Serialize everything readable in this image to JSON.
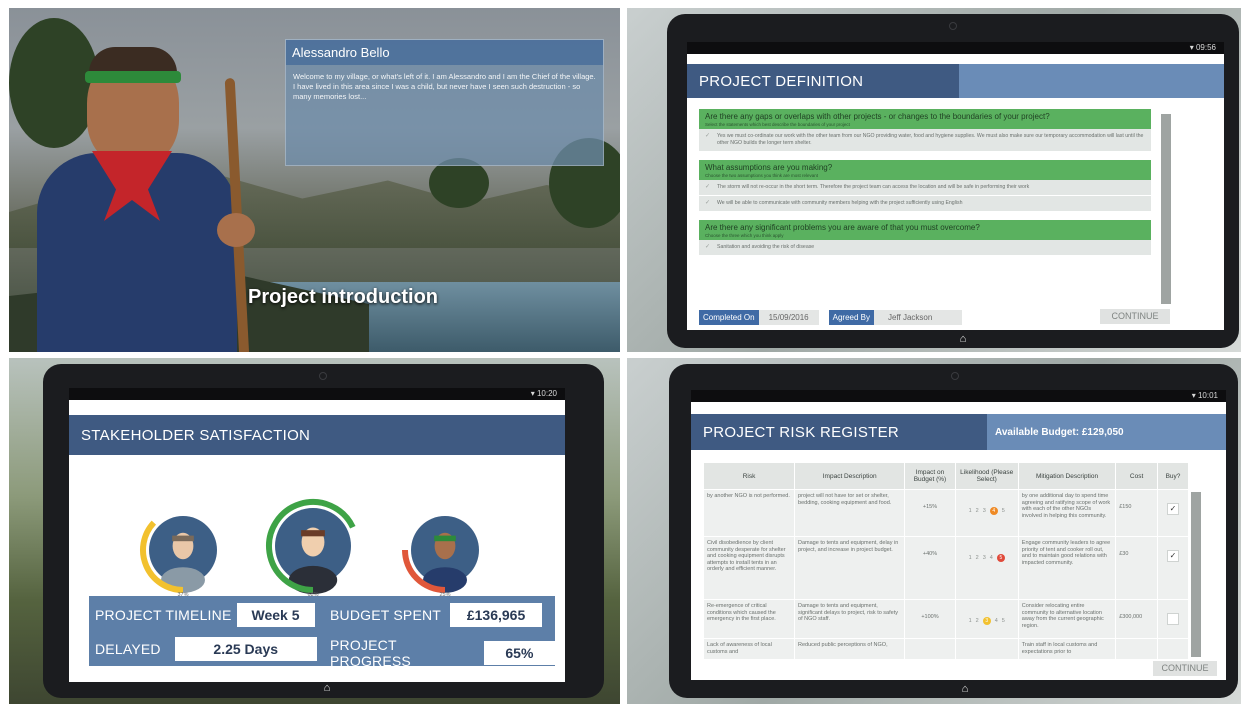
{
  "q1": {
    "character_name": "Alessandro Bello",
    "dialog": "Welcome to my village, or what's left of it. I am Alessandro and I am the Chief of the village. I have lived in this area since I was a child, but never have I seen such destruction - so many memories lost...",
    "title": "Project introduction",
    "character_icon": "village-chief-avatar"
  },
  "q2": {
    "time": "09:56",
    "title": "PROJECT DEFINITION",
    "sections": [
      {
        "question": "Are there any gaps or overlaps with other projects - or changes to the boundaries of your project?",
        "sub": "Select the statements which best describe the boundaries of your project",
        "answers": [
          "Yes we must co-ordinate our work with the other team from our NGO providing water, food and hygiene supplies. We must also make sure our temporary accommodation will last until the other NGO builds the longer term shelter."
        ]
      },
      {
        "question": "What assumptions are you making?",
        "sub": "Choose the two assumptions you think are most relevant",
        "answers": [
          "The storm will not re-occur in the short term. Therefore the project team can access the location and will be safe in performing their work",
          "We will be able to communicate with community members helping with the project sufficiently using English"
        ]
      },
      {
        "question": "Are there any significant problems you are aware of that you must overcome?",
        "sub": "Choose the three which you think apply",
        "answers": [
          "Sanitation and avoiding the risk of disease"
        ]
      }
    ],
    "footer": {
      "completed_label": "Completed On",
      "completed_value": "15/09/2016",
      "agreed_label": "Agreed By",
      "agreed_value": "Jeff Jackson",
      "continue_label": "CONTINUE"
    }
  },
  "q3": {
    "time": "10:20",
    "title": "STAKEHOLDER SATISFACTION",
    "stakeholders": [
      {
        "percent": "37%",
        "fraction": 0.37,
        "color": "#f2c12e"
      },
      {
        "percent": "68%",
        "fraction": 0.68,
        "color": "#3ea346"
      },
      {
        "percent": "25%",
        "fraction": 0.25,
        "color": "#e0573a"
      }
    ],
    "stats": {
      "timeline_label": "PROJECT TIMELINE",
      "timeline_value": "Week 5",
      "budget_label": "BUDGET SPENT",
      "budget_value": "£136,965",
      "delayed_label": "DELAYED",
      "delayed_value": "2.25 Days",
      "progress_label": "PROJECT PROGRESS",
      "progress_value": "65%"
    }
  },
  "q4": {
    "time": "10:01",
    "title": "PROJECT RISK REGISTER",
    "budget": "Available Budget: £129,050",
    "columns": [
      "Risk",
      "Impact Description",
      "Impact on Budget (%)",
      "Likelihood (Please Select)",
      "Mitigation Description",
      "Cost",
      "Buy?"
    ],
    "rows": [
      {
        "risk": "by another NGO is not performed.",
        "impact": "project will not have tor set or shelter, bedding, cooking equipment and food.",
        "budget": "+15%",
        "likelihood": [
          "1",
          "2",
          "3",
          "4",
          "5"
        ],
        "selected_index": 3,
        "sel_color": "#ef8a25",
        "mitigation": "by one additional day to spend time agreeing and ratifying scope of work with each of the other NGOs involved in helping this community.",
        "cost": "£150",
        "buy": "✓"
      },
      {
        "risk": "Civil disobedience by client community desperate for shelter and cooking equipment disrupts attempts to install tents in an orderly and efficient manner.",
        "impact": "Damage to tents and equipment, delay in project, and increase in project budget.",
        "budget": "+40%",
        "likelihood": [
          "1",
          "2",
          "3",
          "4",
          "5"
        ],
        "selected_index": 4,
        "sel_color": "#e04a3a",
        "mitigation": "Engage community leaders to agree priority of tent and cooker roll out, and to maintain good relations with impacted community.",
        "cost": "£30",
        "buy": "✓"
      },
      {
        "risk": "Re-emergence of critical conditions which caused the emergency in the first place.",
        "impact": "Damage to tents and equipment, significant delays to project, risk to safety of NGO staff.",
        "budget": "+100%",
        "likelihood": [
          "1",
          "2",
          "3",
          "4",
          "5"
        ],
        "selected_index": 2,
        "sel_color": "#f2c12e",
        "mitigation": "Consider relocating entire community to alternative location away from the current geographic region.",
        "cost": "£300,000",
        "buy": ""
      },
      {
        "risk": "Lack of awareness of local customs and",
        "impact": "Reduced public perceptions of NGO,",
        "budget": "",
        "likelihood": [],
        "selected_index": -1,
        "sel_color": "#cccccc",
        "mitigation": "Train staff in local customs and expectations prior to",
        "cost": "",
        "buy": ""
      }
    ],
    "continue_label": "CONTINUE"
  },
  "icons": {
    "home": "⌂",
    "wifi": "▾",
    "check": "✓"
  }
}
